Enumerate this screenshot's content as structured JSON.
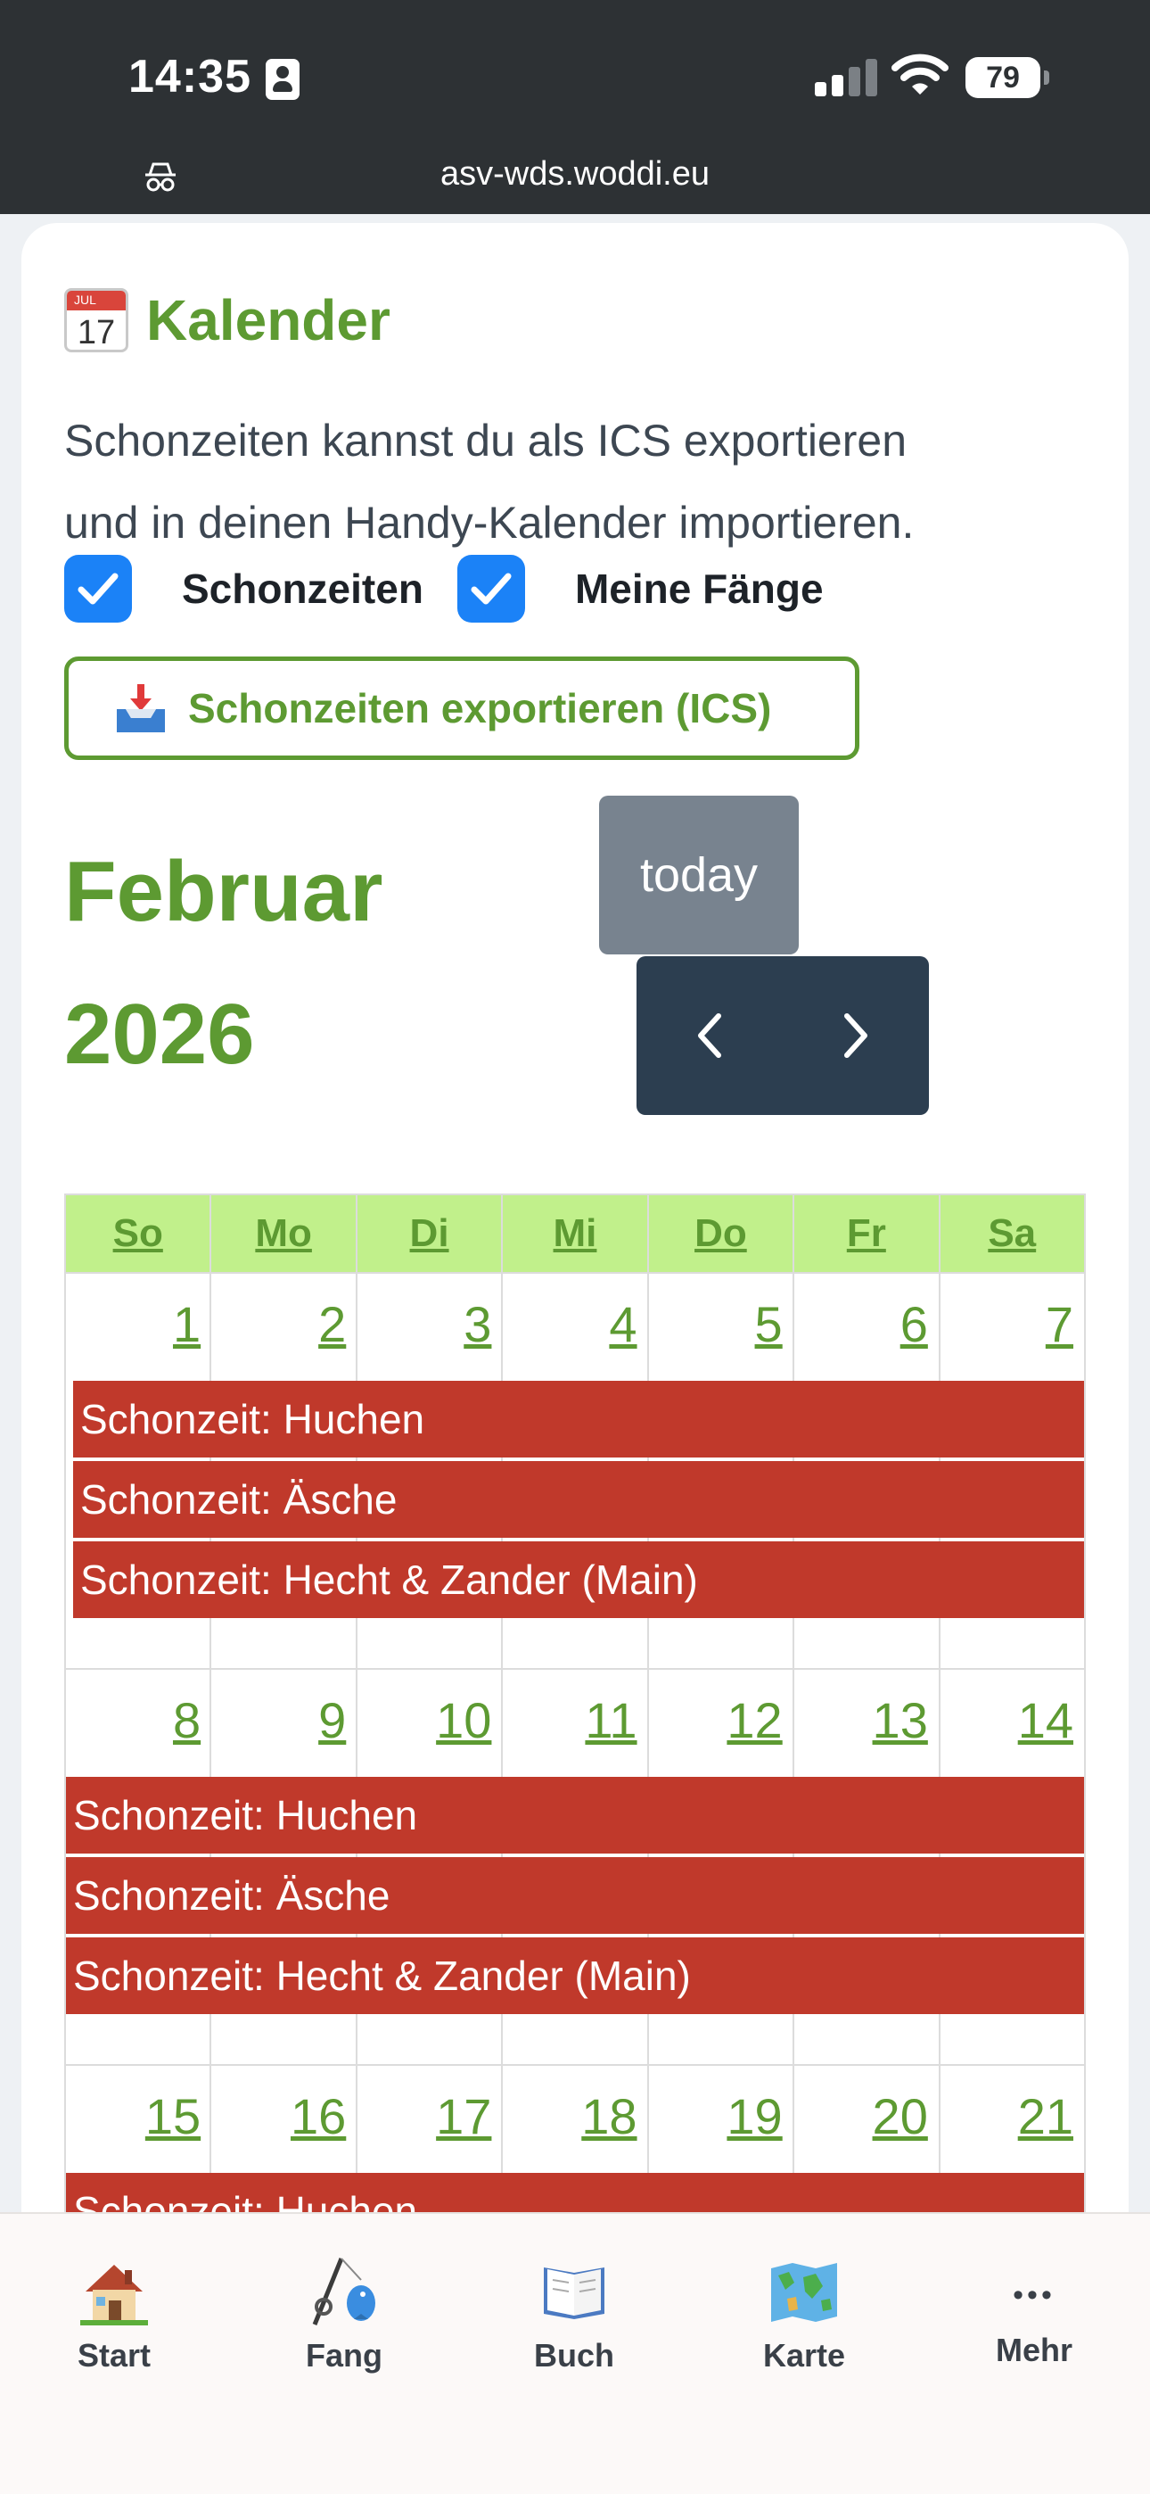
{
  "status_bar": {
    "time": "14:35",
    "battery": "79"
  },
  "browser": {
    "url": "asv-wds.woddi.eu"
  },
  "calendar_card": {
    "emoji_month": "JUL",
    "emoji_day": "17",
    "title": "Kalender",
    "intro_line1": "Schonzeiten kannst du als ICS exportieren",
    "intro_line2": "und in deinen Handy-Kalender importieren.",
    "filter_closed_seasons": "Schonzeiten",
    "filter_my_catches": "Meine Fänge",
    "export_button": "Schonzeiten exportieren (ICS)"
  },
  "calendar": {
    "month": "Februar",
    "year": "2026",
    "today_button": "today",
    "weekdays": [
      "So",
      "Mo",
      "Di",
      "Mi",
      "Do",
      "Fr",
      "Sa"
    ],
    "weeks": [
      {
        "days": [
          "1",
          "2",
          "3",
          "4",
          "5",
          "6",
          "7"
        ],
        "events": [
          "Schonzeit: Huchen",
          "Schonzeit: Äsche",
          "Schonzeit: Hecht & Zander (Main)"
        ]
      },
      {
        "days": [
          "8",
          "9",
          "10",
          "11",
          "12",
          "13",
          "14"
        ],
        "events": [
          "Schonzeit: Huchen",
          "Schonzeit: Äsche",
          "Schonzeit: Hecht & Zander (Main)"
        ]
      },
      {
        "days": [
          "15",
          "16",
          "17",
          "18",
          "19",
          "20",
          "21"
        ],
        "events": [
          "Schonzeit: Huchen"
        ]
      }
    ]
  },
  "tabbar": {
    "start": "Start",
    "catch": "Fang",
    "book": "Buch",
    "map": "Karte",
    "more": "Mehr",
    "more_icon": "•••"
  },
  "colors": {
    "brand_green": "#5d9a32",
    "closed_season_red": "#c0392b",
    "header_green": "#c1f08b",
    "nav_dark": "#2c3e50",
    "checkbox_blue": "#1b82f7"
  }
}
